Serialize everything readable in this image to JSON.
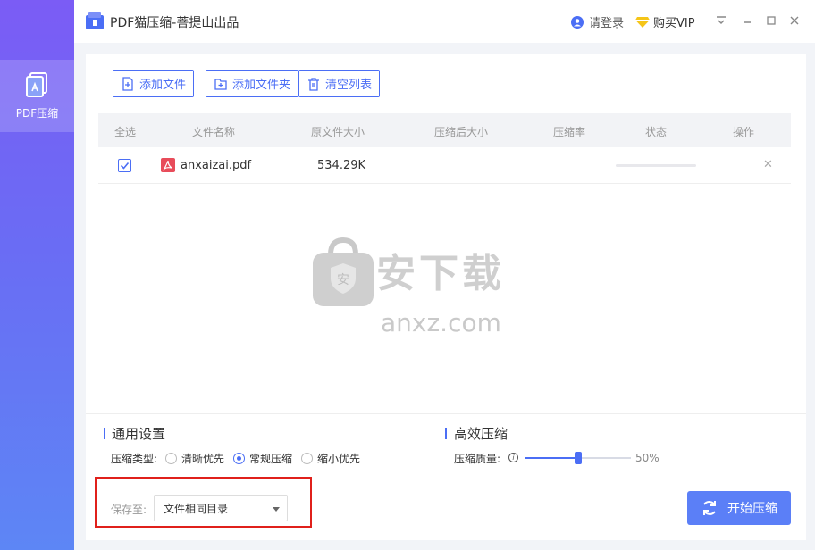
{
  "app": {
    "title": "PDF猫压缩-菩提山出品"
  },
  "header": {
    "login": "请登录",
    "vip": "购买VIP"
  },
  "sidebar": {
    "items": [
      {
        "label": "PDF压缩",
        "icon": "pdf-file-icon"
      }
    ]
  },
  "toolbar": {
    "add_file": "添加文件",
    "add_folder": "添加文件夹",
    "clear_list": "清空列表"
  },
  "table": {
    "headers": [
      "全选",
      "文件名称",
      "原文件大小",
      "压缩后大小",
      "压缩率",
      "状态",
      "操作"
    ],
    "rows": [
      {
        "name": "anxaizai.pdf",
        "original_size": "534.29K",
        "compressed_size": "",
        "ratio": "",
        "progress": 0,
        "checked": true
      }
    ]
  },
  "watermark": {
    "cn": "安下载",
    "en": "anxz.com"
  },
  "general_settings": {
    "title": "通用设置",
    "type_label": "压缩类型:",
    "options": [
      "清晰优先",
      "常规压缩",
      "缩小优先"
    ],
    "selected": "常规压缩"
  },
  "efficient": {
    "title": "高效压缩",
    "quality_label": "压缩质量:",
    "quality_value": "50%",
    "quality": 0.5
  },
  "save": {
    "label": "保存至:",
    "value": "文件相同目录"
  },
  "start_button": "开始压缩",
  "colors": {
    "accent": "#4b6ef5",
    "button": "#5b7ff7",
    "highlight_box": "#e0201b",
    "pdf_icon": "#e84c5a"
  }
}
